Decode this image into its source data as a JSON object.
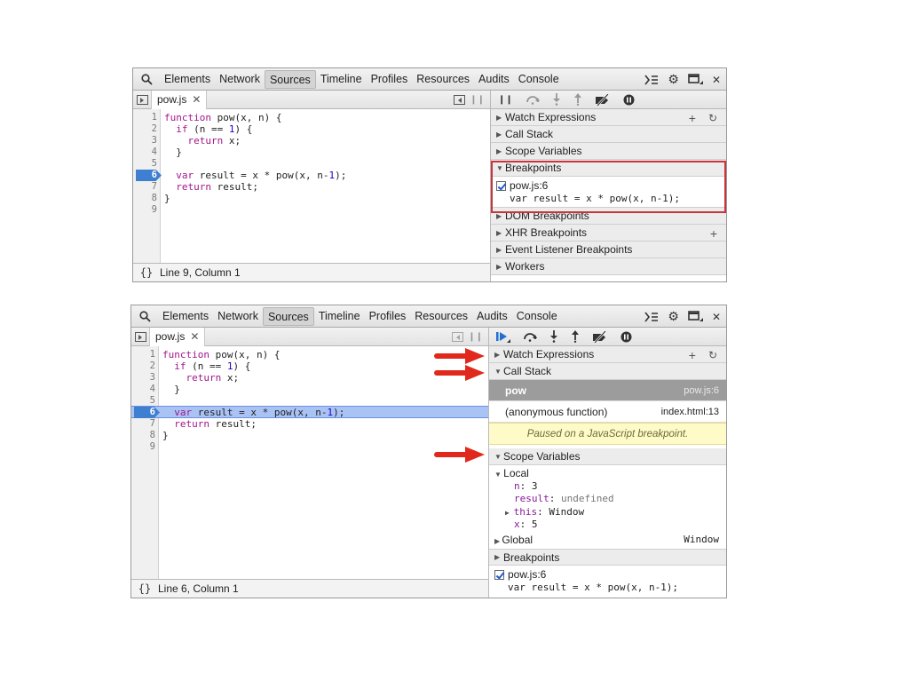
{
  "tabs": [
    "Elements",
    "Network",
    "Sources",
    "Timeline",
    "Profiles",
    "Resources",
    "Audits",
    "Console"
  ],
  "selected_tab": "Sources",
  "file_tab": "pow.js",
  "code": [
    {
      "n": "1",
      "t": "function pow(x, n) {"
    },
    {
      "n": "2",
      "t": "  if (n == 1) {"
    },
    {
      "n": "3",
      "t": "    return x;"
    },
    {
      "n": "4",
      "t": "  }"
    },
    {
      "n": "5",
      "t": ""
    },
    {
      "n": "6",
      "t": "  var result = x * pow(x, n-1);"
    },
    {
      "n": "7",
      "t": "  return result;"
    },
    {
      "n": "8",
      "t": "}"
    },
    {
      "n": "9",
      "t": ""
    }
  ],
  "panel1": {
    "status": "Line 9, Column 1",
    "panes": {
      "watch": "Watch Expressions",
      "call_stack": "Call Stack",
      "scope": "Scope Variables",
      "breakpoints": "Breakpoints",
      "dom": "DOM Breakpoints",
      "xhr": "XHR Breakpoints",
      "event": "Event Listener Breakpoints",
      "workers": "Workers"
    },
    "breakpoint": {
      "file": "pow.js:6",
      "code": "var result = x * pow(x, n-1);"
    }
  },
  "panel2": {
    "status": "Line 6, Column 1",
    "panes": {
      "watch": "Watch Expressions",
      "call_stack": "Call Stack",
      "scope": "Scope Variables",
      "breakpoints": "Breakpoints"
    },
    "call_stack": [
      {
        "fn": "pow",
        "loc": "pow.js:6"
      },
      {
        "fn": "(anonymous function)",
        "loc": "index.html:13"
      }
    ],
    "paused_message": "Paused on a JavaScript breakpoint.",
    "scope": {
      "local_label": "Local",
      "n_key": "n",
      "n_val": "3",
      "result_key": "result",
      "result_val": "undefined",
      "this_key": "this",
      "this_val": "Window",
      "x_key": "x",
      "x_val": "5",
      "global_label": "Global",
      "global_val": "Window"
    },
    "breakpoint": {
      "file": "pow.js:6",
      "code": "var result = x * pow(x, n-1);"
    }
  },
  "colors": {
    "breakpoint_marker": "#3e7fd1",
    "exec_line": "#a9c3f5",
    "highlight_box": "#c9353b",
    "arrow": "#e0291c"
  }
}
